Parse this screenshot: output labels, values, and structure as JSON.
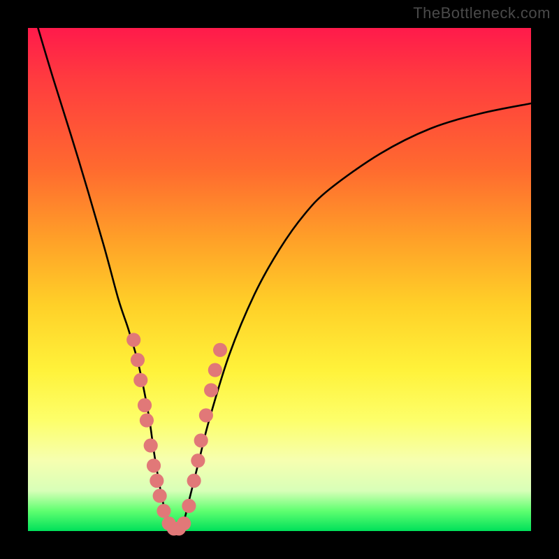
{
  "watermark": {
    "text": "TheBottleneck.com"
  },
  "chart_data": {
    "type": "line",
    "title": "",
    "xlabel": "",
    "ylabel": "",
    "xlim": [
      0,
      100
    ],
    "ylim": [
      0,
      100
    ],
    "background_gradient_meaning": "green (bottom) = good / no bottleneck, red (top) = severe bottleneck",
    "series": [
      {
        "name": "bottleneck-curve",
        "color": "#000000",
        "x": [
          2,
          5,
          10,
          15,
          18,
          20,
          22,
          24,
          25,
          26,
          27,
          28,
          29,
          30,
          31,
          32,
          34,
          36,
          40,
          45,
          50,
          55,
          60,
          70,
          80,
          90,
          100
        ],
        "y": [
          100,
          90,
          74,
          57,
          46,
          40,
          33,
          23,
          16,
          10,
          5,
          2,
          0,
          0,
          2,
          6,
          14,
          22,
          35,
          47,
          56,
          63,
          68,
          75,
          80,
          83,
          85
        ]
      }
    ],
    "highlight_points": {
      "name": "sample-configs",
      "color": "#e17878",
      "radius_pct": 1.4,
      "points": [
        {
          "x": 21.0,
          "y": 38
        },
        {
          "x": 21.8,
          "y": 34
        },
        {
          "x": 22.4,
          "y": 30
        },
        {
          "x": 23.2,
          "y": 25
        },
        {
          "x": 23.6,
          "y": 22
        },
        {
          "x": 24.4,
          "y": 17
        },
        {
          "x": 25.0,
          "y": 13
        },
        {
          "x": 25.6,
          "y": 10
        },
        {
          "x": 26.2,
          "y": 7
        },
        {
          "x": 27.0,
          "y": 4
        },
        {
          "x": 28.0,
          "y": 1.5
        },
        {
          "x": 29.0,
          "y": 0.5
        },
        {
          "x": 30.0,
          "y": 0.5
        },
        {
          "x": 31.0,
          "y": 1.5
        },
        {
          "x": 32.0,
          "y": 5
        },
        {
          "x": 33.0,
          "y": 10
        },
        {
          "x": 33.8,
          "y": 14
        },
        {
          "x": 34.4,
          "y": 18
        },
        {
          "x": 35.4,
          "y": 23
        },
        {
          "x": 36.4,
          "y": 28
        },
        {
          "x": 37.2,
          "y": 32
        },
        {
          "x": 38.2,
          "y": 36
        }
      ]
    }
  }
}
